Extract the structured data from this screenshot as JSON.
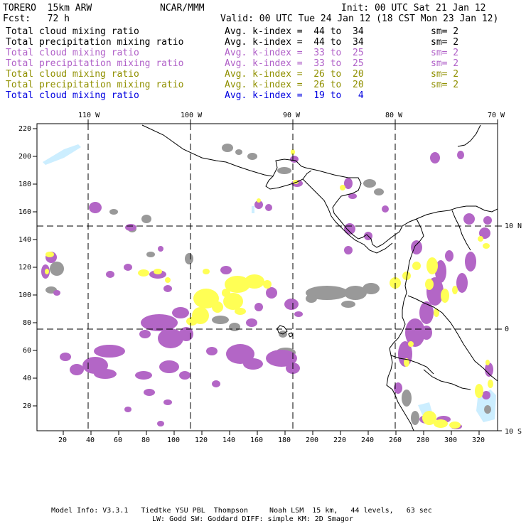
{
  "header": {
    "model": "TORERO  15km ARW",
    "org": "NCAR/MMM",
    "init": "Init: 00 UTC Sat 21 Jan 12",
    "fcst": "Fcst:   72 h",
    "valid": "Valid: 00 UTC Tue 24 Jan 12 (18 CST Mon 23 Jan 12)"
  },
  "fields": [
    {
      "name": "Total cloud mixing ratio",
      "range": "Avg. k-index =  44 to  34",
      "sm": "sm= 2",
      "color": "#000000"
    },
    {
      "name": "Total precipitation mixing ratio",
      "range": "Avg. k-index =  44 to  34",
      "sm": "sm= 2",
      "color": "#000000"
    },
    {
      "name": "Total cloud mixing ratio",
      "range": "Avg. k-index =  33 to  25",
      "sm": "sm= 2",
      "color": "#b060c8"
    },
    {
      "name": "Total precipitation mixing ratio",
      "range": "Avg. k-index =  33 to  25",
      "sm": "sm= 2",
      "color": "#b060c8"
    },
    {
      "name": "Total cloud mixing ratio",
      "range": "Avg. k-index =  26 to  20",
      "sm": "sm= 2",
      "color": "#909000"
    },
    {
      "name": "Total precipitation mixing ratio",
      "range": "Avg. k-index =  26 to  20",
      "sm": "sm= 2",
      "color": "#909000"
    },
    {
      "name": "Total cloud mixing ratio",
      "range": "Avg. k-index =  19 to   4",
      "sm": "",
      "color": "#0000e0"
    }
  ],
  "map": {
    "lon_labels": [
      "110 W",
      "100 W",
      "90 W",
      "80 W",
      "70 W"
    ],
    "lat_labels": [
      "10 N",
      "0",
      "10 S"
    ],
    "y_ticks": [
      "220",
      "200",
      "180",
      "160",
      "140",
      "120",
      "100",
      "80",
      "60",
      "40",
      "20"
    ],
    "x_ticks": [
      "20",
      "40",
      "60",
      "80",
      "100",
      "120",
      "140",
      "160",
      "180",
      "200",
      "220",
      "240",
      "260",
      "280",
      "300",
      "320"
    ],
    "colors": {
      "gray": "#999999",
      "purple": "#b366c6",
      "yellow": "#ffff55",
      "light_blue": "#cceeff",
      "coast": "#000000"
    }
  },
  "footer": {
    "line1": "Model Info: V3.3.1   Tiedtke YSU PBL  Thompson     Noah LSM  15 km,   44 levels,   63 sec",
    "line2": "LW: Godd SW: Goddard DIFF: simple KM: 2D Smagor"
  }
}
